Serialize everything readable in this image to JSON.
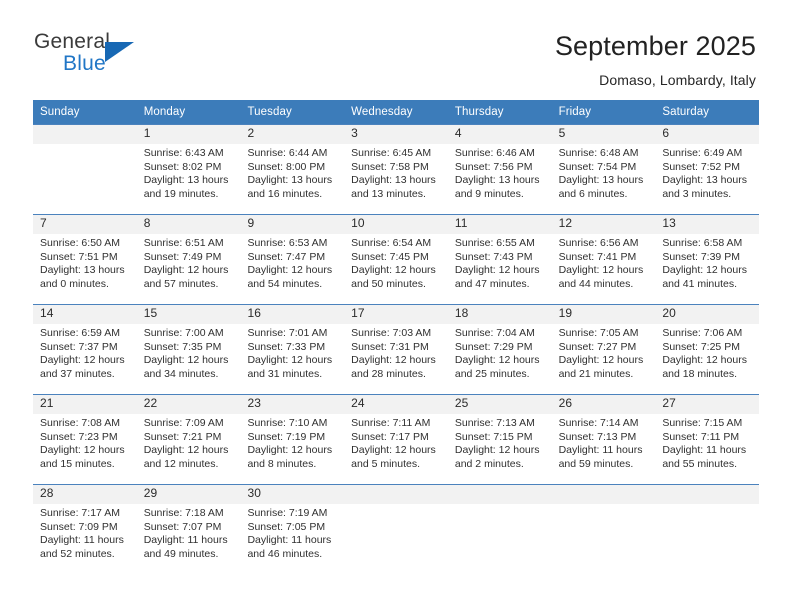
{
  "brand": {
    "general": "General",
    "blue": "Blue",
    "triangle_color": "#1768b4"
  },
  "header": {
    "title": "September 2025",
    "subtitle": "Domaso, Lombardy, Italy"
  },
  "colors": {
    "header_blue": "#3c7cba",
    "row_divider_blue": "#4b82bd",
    "daynumber_band": "#f2f2f2",
    "brand_blue": "#2076c6"
  },
  "weekdays": [
    "Sunday",
    "Monday",
    "Tuesday",
    "Wednesday",
    "Thursday",
    "Friday",
    "Saturday"
  ],
  "weeks": [
    [
      {
        "day": "",
        "sunrise": "",
        "sunset": "",
        "daylight1": "",
        "daylight2": ""
      },
      {
        "day": "1",
        "sunrise": "Sunrise: 6:43 AM",
        "sunset": "Sunset: 8:02 PM",
        "daylight1": "Daylight: 13 hours",
        "daylight2": "and 19 minutes."
      },
      {
        "day": "2",
        "sunrise": "Sunrise: 6:44 AM",
        "sunset": "Sunset: 8:00 PM",
        "daylight1": "Daylight: 13 hours",
        "daylight2": "and 16 minutes."
      },
      {
        "day": "3",
        "sunrise": "Sunrise: 6:45 AM",
        "sunset": "Sunset: 7:58 PM",
        "daylight1": "Daylight: 13 hours",
        "daylight2": "and 13 minutes."
      },
      {
        "day": "4",
        "sunrise": "Sunrise: 6:46 AM",
        "sunset": "Sunset: 7:56 PM",
        "daylight1": "Daylight: 13 hours",
        "daylight2": "and 9 minutes."
      },
      {
        "day": "5",
        "sunrise": "Sunrise: 6:48 AM",
        "sunset": "Sunset: 7:54 PM",
        "daylight1": "Daylight: 13 hours",
        "daylight2": "and 6 minutes."
      },
      {
        "day": "6",
        "sunrise": "Sunrise: 6:49 AM",
        "sunset": "Sunset: 7:52 PM",
        "daylight1": "Daylight: 13 hours",
        "daylight2": "and 3 minutes."
      }
    ],
    [
      {
        "day": "7",
        "sunrise": "Sunrise: 6:50 AM",
        "sunset": "Sunset: 7:51 PM",
        "daylight1": "Daylight: 13 hours",
        "daylight2": "and 0 minutes."
      },
      {
        "day": "8",
        "sunrise": "Sunrise: 6:51 AM",
        "sunset": "Sunset: 7:49 PM",
        "daylight1": "Daylight: 12 hours",
        "daylight2": "and 57 minutes."
      },
      {
        "day": "9",
        "sunrise": "Sunrise: 6:53 AM",
        "sunset": "Sunset: 7:47 PM",
        "daylight1": "Daylight: 12 hours",
        "daylight2": "and 54 minutes."
      },
      {
        "day": "10",
        "sunrise": "Sunrise: 6:54 AM",
        "sunset": "Sunset: 7:45 PM",
        "daylight1": "Daylight: 12 hours",
        "daylight2": "and 50 minutes."
      },
      {
        "day": "11",
        "sunrise": "Sunrise: 6:55 AM",
        "sunset": "Sunset: 7:43 PM",
        "daylight1": "Daylight: 12 hours",
        "daylight2": "and 47 minutes."
      },
      {
        "day": "12",
        "sunrise": "Sunrise: 6:56 AM",
        "sunset": "Sunset: 7:41 PM",
        "daylight1": "Daylight: 12 hours",
        "daylight2": "and 44 minutes."
      },
      {
        "day": "13",
        "sunrise": "Sunrise: 6:58 AM",
        "sunset": "Sunset: 7:39 PM",
        "daylight1": "Daylight: 12 hours",
        "daylight2": "and 41 minutes."
      }
    ],
    [
      {
        "day": "14",
        "sunrise": "Sunrise: 6:59 AM",
        "sunset": "Sunset: 7:37 PM",
        "daylight1": "Daylight: 12 hours",
        "daylight2": "and 37 minutes."
      },
      {
        "day": "15",
        "sunrise": "Sunrise: 7:00 AM",
        "sunset": "Sunset: 7:35 PM",
        "daylight1": "Daylight: 12 hours",
        "daylight2": "and 34 minutes."
      },
      {
        "day": "16",
        "sunrise": "Sunrise: 7:01 AM",
        "sunset": "Sunset: 7:33 PM",
        "daylight1": "Daylight: 12 hours",
        "daylight2": "and 31 minutes."
      },
      {
        "day": "17",
        "sunrise": "Sunrise: 7:03 AM",
        "sunset": "Sunset: 7:31 PM",
        "daylight1": "Daylight: 12 hours",
        "daylight2": "and 28 minutes."
      },
      {
        "day": "18",
        "sunrise": "Sunrise: 7:04 AM",
        "sunset": "Sunset: 7:29 PM",
        "daylight1": "Daylight: 12 hours",
        "daylight2": "and 25 minutes."
      },
      {
        "day": "19",
        "sunrise": "Sunrise: 7:05 AM",
        "sunset": "Sunset: 7:27 PM",
        "daylight1": "Daylight: 12 hours",
        "daylight2": "and 21 minutes."
      },
      {
        "day": "20",
        "sunrise": "Sunrise: 7:06 AM",
        "sunset": "Sunset: 7:25 PM",
        "daylight1": "Daylight: 12 hours",
        "daylight2": "and 18 minutes."
      }
    ],
    [
      {
        "day": "21",
        "sunrise": "Sunrise: 7:08 AM",
        "sunset": "Sunset: 7:23 PM",
        "daylight1": "Daylight: 12 hours",
        "daylight2": "and 15 minutes."
      },
      {
        "day": "22",
        "sunrise": "Sunrise: 7:09 AM",
        "sunset": "Sunset: 7:21 PM",
        "daylight1": "Daylight: 12 hours",
        "daylight2": "and 12 minutes."
      },
      {
        "day": "23",
        "sunrise": "Sunrise: 7:10 AM",
        "sunset": "Sunset: 7:19 PM",
        "daylight1": "Daylight: 12 hours",
        "daylight2": "and 8 minutes."
      },
      {
        "day": "24",
        "sunrise": "Sunrise: 7:11 AM",
        "sunset": "Sunset: 7:17 PM",
        "daylight1": "Daylight: 12 hours",
        "daylight2": "and 5 minutes."
      },
      {
        "day": "25",
        "sunrise": "Sunrise: 7:13 AM",
        "sunset": "Sunset: 7:15 PM",
        "daylight1": "Daylight: 12 hours",
        "daylight2": "and 2 minutes."
      },
      {
        "day": "26",
        "sunrise": "Sunrise: 7:14 AM",
        "sunset": "Sunset: 7:13 PM",
        "daylight1": "Daylight: 11 hours",
        "daylight2": "and 59 minutes."
      },
      {
        "day": "27",
        "sunrise": "Sunrise: 7:15 AM",
        "sunset": "Sunset: 7:11 PM",
        "daylight1": "Daylight: 11 hours",
        "daylight2": "and 55 minutes."
      }
    ],
    [
      {
        "day": "28",
        "sunrise": "Sunrise: 7:17 AM",
        "sunset": "Sunset: 7:09 PM",
        "daylight1": "Daylight: 11 hours",
        "daylight2": "and 52 minutes."
      },
      {
        "day": "29",
        "sunrise": "Sunrise: 7:18 AM",
        "sunset": "Sunset: 7:07 PM",
        "daylight1": "Daylight: 11 hours",
        "daylight2": "and 49 minutes."
      },
      {
        "day": "30",
        "sunrise": "Sunrise: 7:19 AM",
        "sunset": "Sunset: 7:05 PM",
        "daylight1": "Daylight: 11 hours",
        "daylight2": "and 46 minutes."
      },
      {
        "day": "",
        "sunrise": "",
        "sunset": "",
        "daylight1": "",
        "daylight2": ""
      },
      {
        "day": "",
        "sunrise": "",
        "sunset": "",
        "daylight1": "",
        "daylight2": ""
      },
      {
        "day": "",
        "sunrise": "",
        "sunset": "",
        "daylight1": "",
        "daylight2": ""
      },
      {
        "day": "",
        "sunrise": "",
        "sunset": "",
        "daylight1": "",
        "daylight2": ""
      }
    ]
  ]
}
